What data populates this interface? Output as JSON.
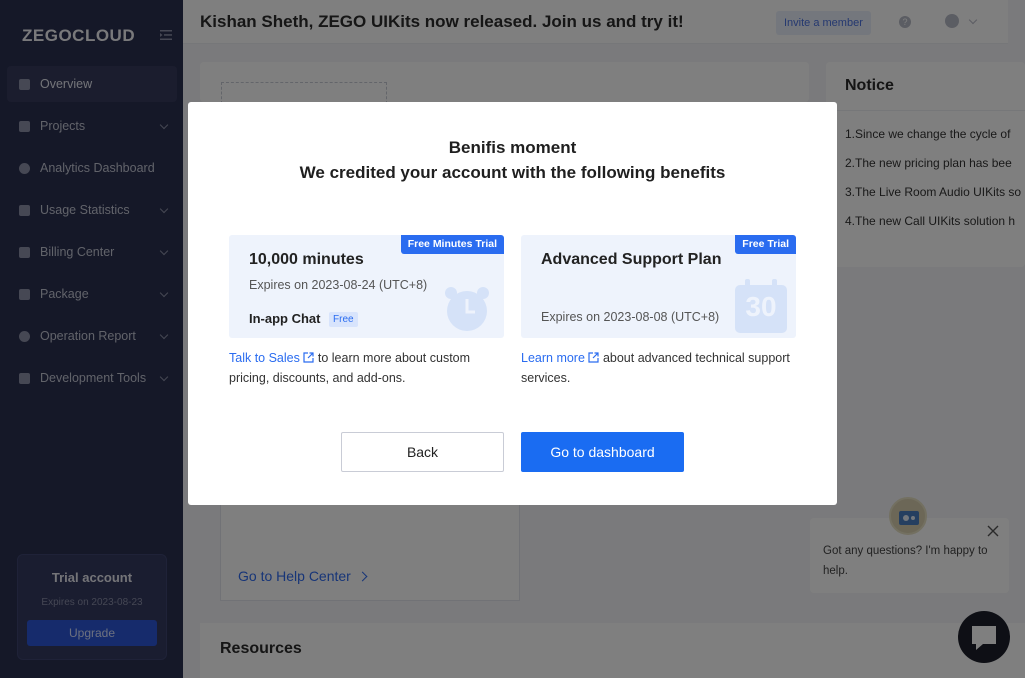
{
  "sidebar": {
    "logo": "ZEGOCLOUD",
    "items": [
      {
        "label": "Overview"
      },
      {
        "label": "Projects"
      },
      {
        "label": "Analytics Dashboard"
      },
      {
        "label": "Usage Statistics"
      },
      {
        "label": "Billing Center"
      },
      {
        "label": "Package"
      },
      {
        "label": "Operation Report"
      },
      {
        "label": "Development Tools"
      }
    ],
    "trial": {
      "title": "Trial account",
      "expires": "Expires on 2023-08-23",
      "upgrade": "Upgrade"
    }
  },
  "header": {
    "announcement": "Kishan Sheth, ZEGO UIKits now released. Join us and try it!",
    "invite": "Invite a member",
    "help": "?"
  },
  "notice": {
    "title": "Notice",
    "items": [
      "1.Since we change the cycle of",
      "2.The new pricing plan has bee",
      "3.The Live Room Audio UIKits so",
      "4.The new Call UIKits solution h"
    ]
  },
  "help_center": {
    "link": "Go to Help Center"
  },
  "resources": {
    "title": "Resources"
  },
  "modal": {
    "title_line1": "Benifis moment",
    "title_line2": "We credited your account with the following benefits",
    "benefits": [
      {
        "badge": "Free Minutes Trial",
        "title": "10,000 minutes",
        "expires": "Expires on 2023-08-24 (UTC+8)",
        "extra": "In-app Chat",
        "extra_tag": "Free",
        "desc_link": "Talk to Sales",
        "desc_text": "to learn more about custom pricing, discounts, and add-ons."
      },
      {
        "badge": "Free Trial",
        "title": "Advanced Support Plan",
        "expires": "Expires on 2023-08-08 (UTC+8)",
        "calendar_number": "30",
        "desc_link": "Learn more",
        "desc_text": "about advanced technical support services."
      }
    ],
    "back": "Back",
    "go_dashboard": "Go to dashboard"
  },
  "chat": {
    "message": "Got any questions? I'm happy to help."
  }
}
